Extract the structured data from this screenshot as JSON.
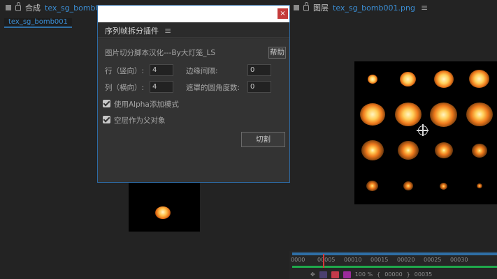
{
  "composition_panel": {
    "header_label": "合成",
    "header_link": "tex_sg_bomb001",
    "tab": "tex_sg_bomb001"
  },
  "layer_panel": {
    "header_label": "图层",
    "header_link": "tex_sg_bomb001.png"
  },
  "timeline": {
    "ruler": [
      "0000",
      "00005",
      "00010",
      "00015",
      "00020",
      "00025",
      "00030"
    ],
    "zoom": "100 %",
    "in_point": "00000",
    "out_point": "00035"
  },
  "dialog": {
    "title": "序列帧拆分插件",
    "description": "图片切分脚本汉化---By大灯笼_LS",
    "help_button": "帮助",
    "rows_label": "行（竖向）:",
    "rows_value": "4",
    "cols_label": "列（横向）:",
    "cols_value": "4",
    "edge_spacing_label": "边缘间隔:",
    "edge_spacing_value": "0",
    "mask_radius_label": "遮罩的圆角度数:",
    "mask_radius_value": "0",
    "alpha_mode_label": "使用Alpha添加模式",
    "alpha_mode_checked": true,
    "null_parent_label": "空层作为父对象",
    "null_parent_checked": true,
    "cut_button": "切割"
  }
}
